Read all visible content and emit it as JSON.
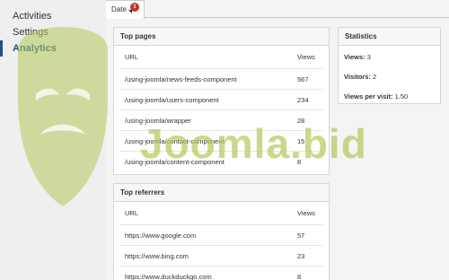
{
  "sidebar": {
    "items": [
      {
        "label": "Activities",
        "active": false
      },
      {
        "label": "Settings",
        "active": false
      },
      {
        "label": "Analytics",
        "active": true
      }
    ]
  },
  "tabs": {
    "date_label": "Date",
    "badge_count": "1"
  },
  "top_pages": {
    "title": "Top pages",
    "col_url": "URL",
    "col_views": "Views",
    "rows": [
      {
        "url": "/using-joomla/news-feeds-component",
        "views": "567"
      },
      {
        "url": "/using-joomla/users-component",
        "views": "234"
      },
      {
        "url": "/using-joomla/wrapper",
        "views": "28"
      },
      {
        "url": "/using-joomla/contact-component",
        "views": "15"
      },
      {
        "url": "/using-joomla/content-component",
        "views": "8"
      }
    ]
  },
  "statistics": {
    "title": "Statistics",
    "views_label": "Views:",
    "views_value": "3",
    "visitors_label": "Visitors:",
    "visitors_value": "2",
    "vpv_label": "Views per visit:",
    "vpv_value": "1.50"
  },
  "top_referrers": {
    "title": "Top referrers",
    "col_url": "URL",
    "col_views": "Views",
    "rows": [
      {
        "url": "https://www.google.com",
        "views": "57"
      },
      {
        "url": "https://www.bing.com",
        "views": "23"
      },
      {
        "url": "https://www.duckduckgo.com",
        "views": "8"
      }
    ]
  },
  "watermark": {
    "text": "Joomla.bid",
    "color": "#b3c95a"
  },
  "colors": {
    "accent": "#205081",
    "badge": "#bd362f"
  }
}
